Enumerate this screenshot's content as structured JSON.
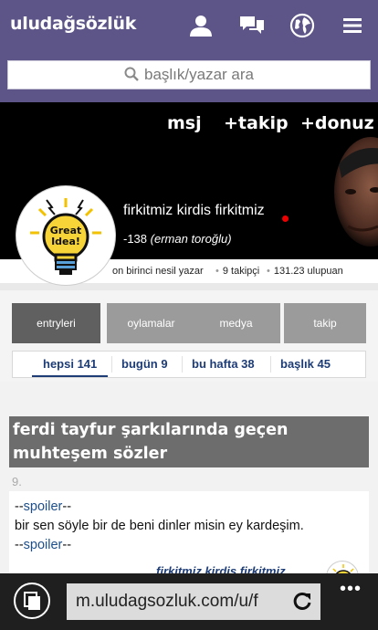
{
  "header": {
    "logo": "uludağsözlük",
    "icons": [
      "user-icon",
      "messages-icon",
      "globe-icon",
      "menu-icon"
    ]
  },
  "search": {
    "placeholder": "başlık/yazar ara"
  },
  "profile": {
    "actions": {
      "msg": "msj",
      "follow": "+takip",
      "donuz": "+donuz"
    },
    "nickname": "firkitmiz kirdis firkitmiz",
    "score": "-138",
    "score_by": "(erman toroğlu)",
    "stats": {
      "generation": "on birinci nesil yazar",
      "followers": "9 takipçi",
      "upvotes": "131.23 ulupuan"
    },
    "avatar_label": [
      "Great",
      "Idea!"
    ]
  },
  "tabs": [
    "entryleri",
    "oylamalar",
    "medya",
    "takip"
  ],
  "subtabs": [
    "hepsi 141",
    "bugün 9",
    "bu hafta 38",
    "başlık 45"
  ],
  "entry": {
    "title": "ferdi tayfur şarkılarında geçen muhteşem sözler",
    "number": "9.",
    "spoiler_open": "--",
    "spoiler_word": "spoiler",
    "spoiler_close": "--",
    "text": "bir sen söyle bir de beni dinler misin ey kardeşim.",
    "author": "firkitmiz kirdis firkitmiz"
  },
  "browser": {
    "url": "m.uludagsozluk.com/u/f",
    "more": "•••"
  },
  "colors": {
    "brand": "#5d5588",
    "tab_active": "#606060",
    "tab": "#9b9b9b",
    "link": "#1e3d76",
    "spoiler": "#1d4e89"
  }
}
